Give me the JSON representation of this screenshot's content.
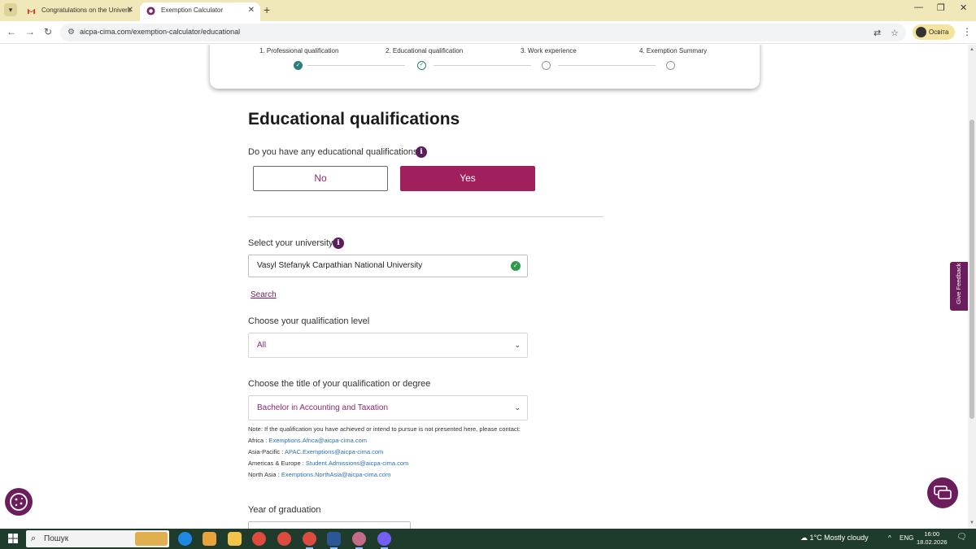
{
  "browser": {
    "tabs": [
      {
        "title": "Congratulations on the Univers",
        "icon": "gmail-icon",
        "active": false
      },
      {
        "title": "Exemption Calculator",
        "icon": "cima-icon",
        "active": true
      }
    ],
    "url": "aicpa-cima.com/exemption-calculator/educational",
    "profile_name": "Освіта"
  },
  "stepper": {
    "steps": [
      {
        "label": "1. Professional qualification",
        "state": "done"
      },
      {
        "label": "2. Educational qualification",
        "state": "current"
      },
      {
        "label": "3. Work experience",
        "state": "todo"
      },
      {
        "label": "4. Exemption Summary",
        "state": "todo"
      }
    ]
  },
  "page": {
    "title": "Educational qualifications",
    "question": "Do you have any educational qualifications?",
    "no_label": "No",
    "yes_label": "Yes",
    "university_label": "Select your university",
    "university_value": "Vasyl Stefanyk Carpathian National University",
    "search_link": "Search",
    "level_label": "Choose your qualification level",
    "level_value": "All",
    "title_label": "Choose the title of your qualification or degree",
    "title_value": "Bachelor in Accounting and Taxation",
    "note": "Note: If the qualification you have achieved or intend to pursue is not presented here, please contact:",
    "contacts": [
      {
        "region": "Africa : ",
        "email": "Exemptions.Africa@aicpa-cima.com"
      },
      {
        "region": "Asia-Pacific : ",
        "email": "APAC.Exemptions@aicpa-cima.com"
      },
      {
        "region": "Americas & Europe : ",
        "email": "Student.Admissions@aicpa-cima.com"
      },
      {
        "region": "North Asia : ",
        "email": "Exemptions.NorthAsia@aicpa-cima.com"
      }
    ],
    "year_label": "Year of graduation",
    "feedback_label": "Give Feedback"
  },
  "taskbar": {
    "search_placeholder": "Пошук",
    "weather": "1°C  Mostly cloudy",
    "lang": "ENG",
    "time": "16:00",
    "date": "18.02.2026"
  },
  "colors": {
    "brand": "#a0205e",
    "brand_dark": "#6b1d5c",
    "step_done": "#2a7f7a",
    "valid": "#2e9a4a"
  }
}
